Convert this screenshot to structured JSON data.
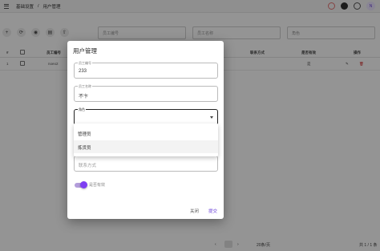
{
  "breadcrumb": [
    "基础设置",
    "/",
    "用户管理"
  ],
  "topbar": {
    "avatar_letter": "N"
  },
  "toolbar": {
    "icons": [
      "add-icon",
      "refresh-icon",
      "view-icon",
      "print-icon",
      "export-icon"
    ],
    "glyphs": [
      "+",
      "⟳",
      "◉",
      "▤",
      "⇧"
    ]
  },
  "filters": {
    "employee_no": "员工编号",
    "employee_name": "员工名称",
    "role": "角色"
  },
  "table": {
    "headers": {
      "index": "#",
      "employee_no": "员工编号",
      "contact": "联系方式",
      "active": "是否有效",
      "actions": "操作"
    },
    "rows": [
      {
        "index": "1",
        "employee_no": "noeo2",
        "active": "是"
      }
    ]
  },
  "pagination": {
    "page_size": "20条/页",
    "range": "共 1 / 1 条"
  },
  "dialog": {
    "title": "用户管理",
    "fields": {
      "employee_no": {
        "label": "员工编号",
        "value": "233"
      },
      "employee_name": {
        "label": "员工名称",
        "value": "不卞"
      },
      "role": {
        "label": "角色",
        "value": ""
      },
      "contact": {
        "placeholder": "联系方式"
      }
    },
    "role_options": [
      "管理员",
      "拣货员"
    ],
    "switch_label": "是否有效",
    "close_label": "关闭",
    "submit_label": "提交"
  }
}
